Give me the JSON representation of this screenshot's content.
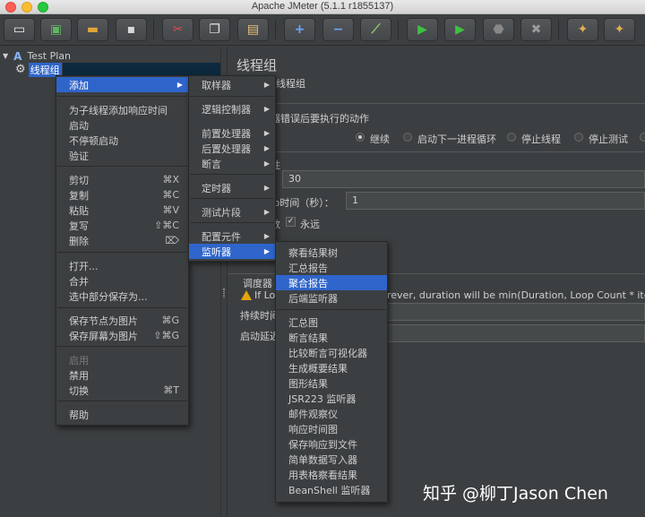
{
  "window": {
    "title": "Apache JMeter (5.1.1 r1855137)"
  },
  "toolbar": {
    "buttons": [
      {
        "name": "new-icon",
        "glyph": "▭",
        "color": "#f2f2f2"
      },
      {
        "name": "templates-icon",
        "glyph": "▣",
        "color": "#5fb55f"
      },
      {
        "name": "open-icon",
        "glyph": "▬",
        "color": "#e0a43a"
      },
      {
        "name": "save-icon",
        "glyph": "▪",
        "color": "#d8d8d8"
      },
      {
        "name": "cut-icon",
        "glyph": "✂",
        "color": "#e04a4a"
      },
      {
        "name": "copy-icon",
        "glyph": "❐",
        "color": "#e6e6e6"
      },
      {
        "name": "paste-icon",
        "glyph": "▤",
        "color": "#e8c07a"
      },
      {
        "name": "expand-icon",
        "glyph": "+",
        "color": "#6aa6ff"
      },
      {
        "name": "collapse-icon",
        "glyph": "−",
        "color": "#6aa6ff"
      },
      {
        "name": "toggle-icon",
        "glyph": "⟋",
        "color": "#8fd16a"
      },
      {
        "name": "start-icon",
        "glyph": "▶",
        "color": "#3fbf3f"
      },
      {
        "name": "start-no-pauses-icon",
        "glyph": "▶",
        "color": "#3fbf3f"
      },
      {
        "name": "stop-icon",
        "glyph": "⬣",
        "color": "#888888"
      },
      {
        "name": "shutdown-icon",
        "glyph": "✖",
        "color": "#9a9a9a"
      },
      {
        "name": "clear-icon",
        "glyph": "✦",
        "color": "#e0b050"
      },
      {
        "name": "clear-all-icon",
        "glyph": "✦",
        "color": "#e0b050"
      }
    ]
  },
  "tree": {
    "root": "Test Plan",
    "child": "线程组"
  },
  "panel": {
    "title": "线程组",
    "name_suffix": "线程组",
    "on_error_label": "器错误后要执行的动作",
    "actions": [
      "继续",
      "启动下一进程循环",
      "停止线程",
      "停止测试"
    ],
    "props_frag": "性",
    "threads_value": "30",
    "rampup_label": "Jp时间（秒）：",
    "rampup_value": "1",
    "loop_frag": "数",
    "forever_label": "永远",
    "scheduler_frag": "调度器",
    "warning_frag_left": "If Lo",
    "warning_frag_right": "rever, duration will be min(Duration, Loop Count * iterat",
    "duration_frag": "持续时间",
    "delay_frag": "启动延迟"
  },
  "context_menu": {
    "items": [
      {
        "label": "添加",
        "submenu": true,
        "highlight": true
      },
      {
        "label": "为子线程添加响应时间"
      },
      {
        "label": "启动"
      },
      {
        "label": "不停顿启动"
      },
      {
        "label": "验证"
      },
      {
        "label": "剪切",
        "shortcut": "⌘X"
      },
      {
        "label": "复制",
        "shortcut": "⌘C"
      },
      {
        "label": "粘贴",
        "shortcut": "⌘V"
      },
      {
        "label": "复写",
        "shortcut": "⇧⌘C"
      },
      {
        "label": "删除",
        "shortcut": "⌦"
      },
      {
        "label": "打开..."
      },
      {
        "label": "合并"
      },
      {
        "label": "选中部分保存为..."
      },
      {
        "label": "保存节点为图片",
        "shortcut": "⌘G"
      },
      {
        "label": "保存屏幕为图片",
        "shortcut": "⇧⌘G"
      },
      {
        "label": "启用",
        "disabled": true
      },
      {
        "label": "禁用"
      },
      {
        "label": "切换",
        "shortcut": "⌘T"
      },
      {
        "label": "帮助"
      }
    ]
  },
  "add_submenu": {
    "items": [
      "取样器",
      "逻辑控制器",
      "前置处理器",
      "后置处理器",
      "断言",
      "定时器",
      "测试片段",
      "配置元件",
      "监听器"
    ]
  },
  "listener_submenu": {
    "items": [
      "察看结果树",
      "汇总报告",
      "聚合报告",
      "后端监听器",
      "汇总图",
      "断言结果",
      "比较断言可视化器",
      "生成概要结果",
      "图形结果",
      "JSR223 监听器",
      "邮件观察仪",
      "响应时间图",
      "保存响应到文件",
      "简单数据写入器",
      "用表格察看结果",
      "BeanShell 监听器"
    ]
  },
  "watermark": "知乎 @柳丁Jason Chen"
}
